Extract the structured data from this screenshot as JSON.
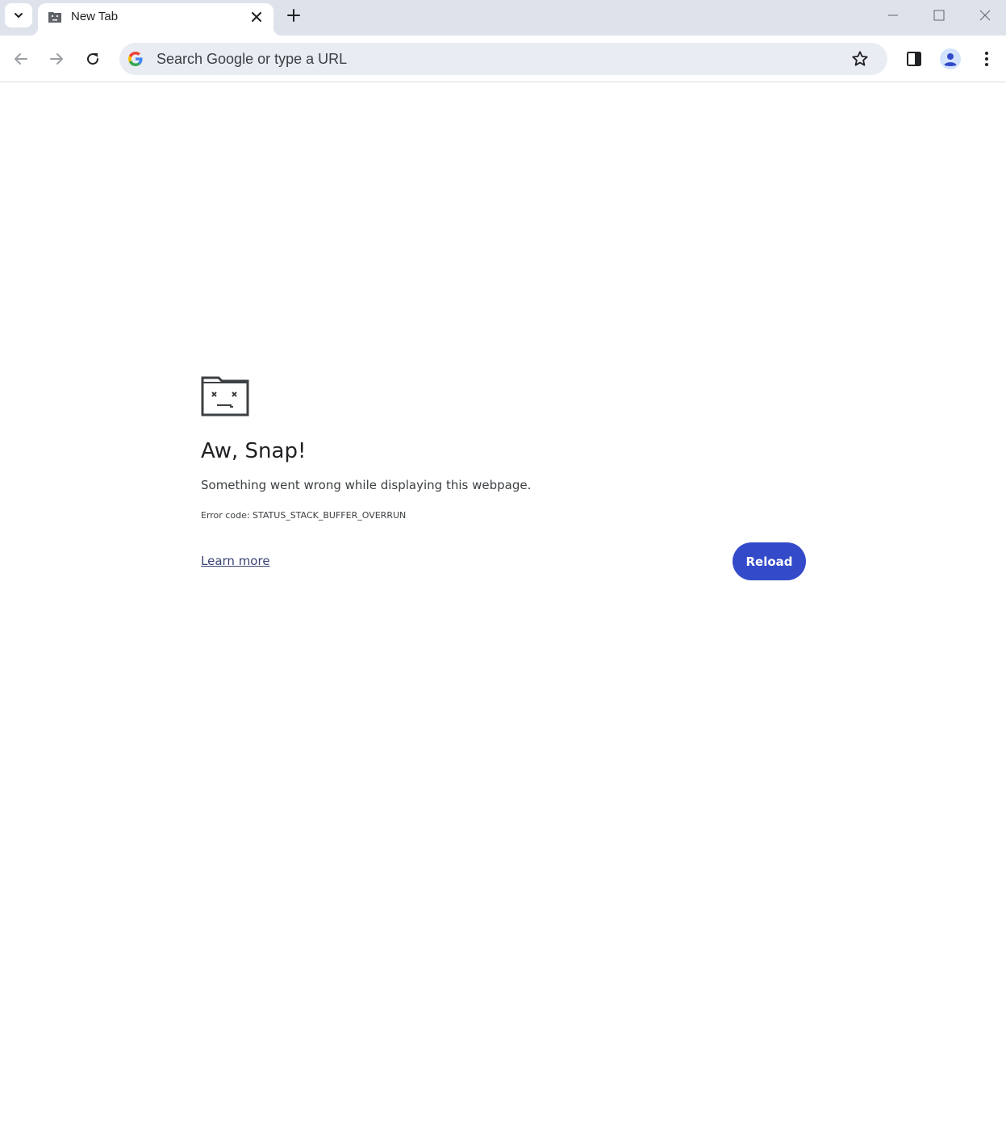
{
  "tabstrip": {
    "tab_search_icon": "chevron-down-icon",
    "tabs": [
      {
        "title": "New Tab",
        "favicon": "sad-tab-icon",
        "active": true
      }
    ],
    "new_tab_icon": "plus-icon"
  },
  "window_controls": [
    "minimize-icon",
    "maximize-icon",
    "close-icon"
  ],
  "toolbar": {
    "back_icon": "arrow-left-icon",
    "forward_icon": "arrow-right-icon",
    "reload_icon": "reload-icon",
    "omnibox": {
      "placeholder": "Search Google or type a URL",
      "value": "",
      "left_icon": "google-g-icon",
      "right_icon": "star-icon"
    },
    "side_panel_icon": "side-panel-icon",
    "profile_icon": "avatar-icon",
    "menu_icon": "kebab-menu-icon"
  },
  "error_page": {
    "icon": "sad-folder-icon",
    "heading": "Aw, Snap!",
    "message": "Something went wrong while displaying this webpage.",
    "error_code": "Error code: STATUS_STACK_BUFFER_OVERRUN",
    "learn_more_label": "Learn more",
    "reload_label": "Reload"
  },
  "colors": {
    "tabstrip_bg": "#dee3eb",
    "omnibox_bg": "#e9edf3",
    "reload_button": "#334ac9",
    "link": "#3b4374"
  }
}
